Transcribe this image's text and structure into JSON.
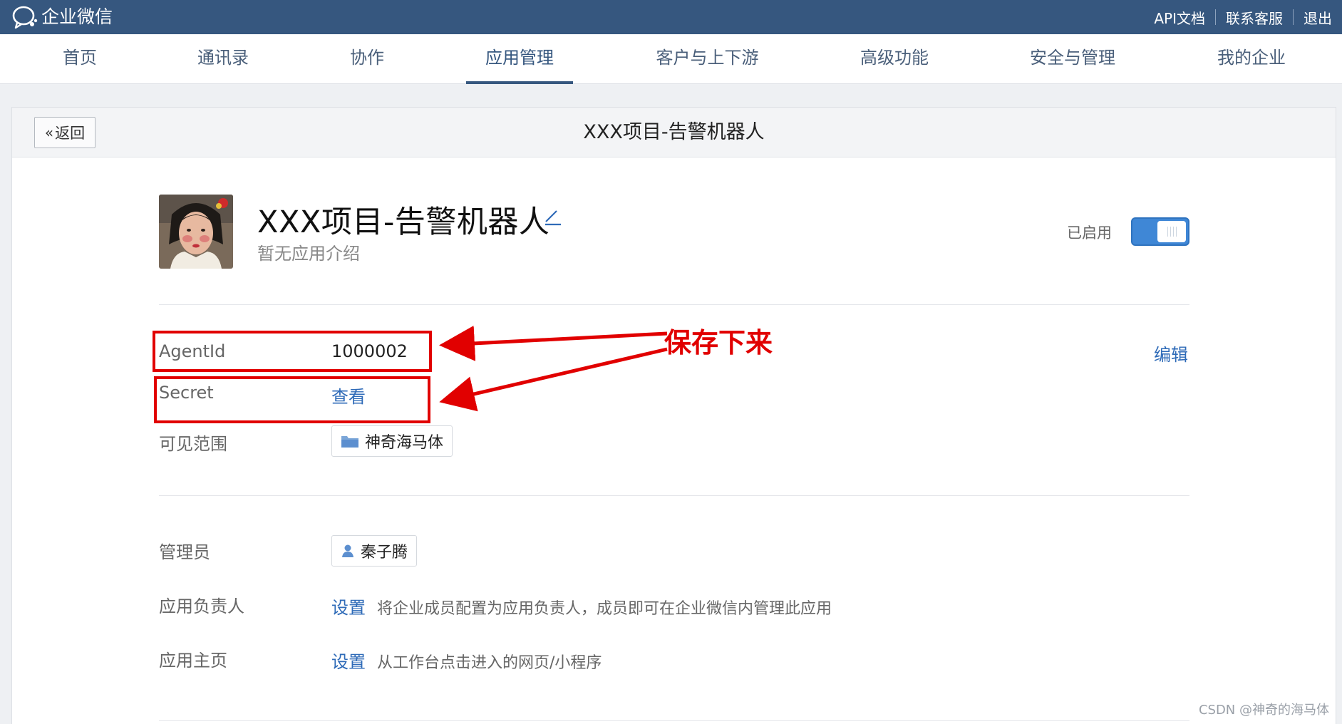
{
  "topbar": {
    "logo_text": "企业微信",
    "links": [
      "API文档",
      "联系客服",
      "退出"
    ]
  },
  "nav": {
    "items": [
      "首页",
      "通讯录",
      "协作",
      "应用管理",
      "客户与上下游",
      "高级功能",
      "安全与管理",
      "我的企业"
    ],
    "active": "应用管理"
  },
  "header": {
    "back_label": "返回",
    "title": "XXX项目-告警机器人"
  },
  "app": {
    "name": "XXX项目-告警机器人",
    "description": "暂无应用介绍",
    "status_label": "已启用",
    "enabled": true
  },
  "fields": {
    "agentid_label": "AgentId",
    "agentid_value": "1000002",
    "secret_label": "Secret",
    "secret_link": "查看",
    "visible_label": "可见范围",
    "visible_value": "神奇海马体",
    "edit_link": "编辑",
    "admin_label": "管理员",
    "admin_value": "秦子腾",
    "owner_label": "应用负责人",
    "owner_link": "设置",
    "owner_desc": "将企业成员配置为应用负责人，成员即可在企业微信内管理此应用",
    "home_label": "应用主页",
    "home_link": "设置",
    "home_desc": "从工作台点击进入的网页/小程序"
  },
  "annotation": {
    "text": "保存下来",
    "color": "#e10000"
  },
  "watermark": "CSDN @神奇的海马体",
  "colors": {
    "topbar": "#36577f",
    "link": "#2f6bb8",
    "toggle": "#3f87d6"
  }
}
